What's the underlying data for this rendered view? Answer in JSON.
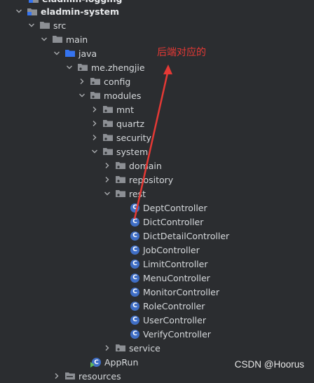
{
  "tree": {
    "partial_top": "eladmin-logging",
    "project": "eladmin-system",
    "src": "src",
    "main": "main",
    "java": "java",
    "pkg": "me.zhengjie",
    "config": "config",
    "modules": "modules",
    "mnt": "mnt",
    "quartz": "quartz",
    "security": "security",
    "system": "system",
    "domain": "domain",
    "repository": "repository",
    "rest": "rest",
    "controllers": [
      "DeptController",
      "DictController",
      "DictDetailController",
      "JobController",
      "LimitController",
      "MenuController",
      "MonitorController",
      "RoleController",
      "UserController",
      "VerifyController"
    ],
    "service": "service",
    "apprun": "AppRun",
    "resources": "resources"
  },
  "annotation": {
    "text": "后端对应的",
    "color": "#e53935"
  },
  "watermark": "CSDN @Hoorus",
  "colors": {
    "background": "#2b2d30",
    "folder": "#8c8f94",
    "java_folder": "#3574f0",
    "class_icon": "#3f6ec5"
  }
}
